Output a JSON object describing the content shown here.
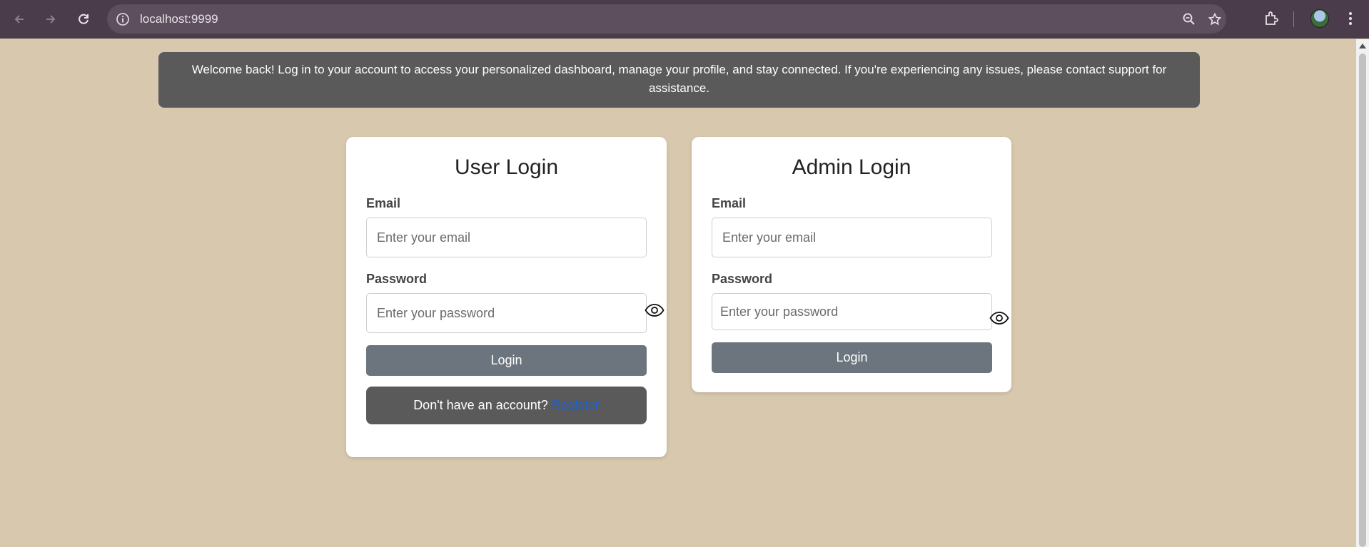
{
  "browser": {
    "url": "localhost:9999",
    "icons": [
      "back-icon",
      "forward-icon",
      "reload-icon",
      "site-info-icon",
      "zoom-icon",
      "bookmark-star-icon",
      "extensions-icon",
      "profile-avatar",
      "menu-icon"
    ]
  },
  "banner": {
    "text": "Welcome back! Log in to your account to access your personalized dashboard, manage your profile, and stay connected. If you're experiencing any issues, please contact support for assistance."
  },
  "user_login": {
    "title": "User Login",
    "email_label": "Email",
    "email_placeholder": "Enter your email",
    "password_label": "Password",
    "password_placeholder": "Enter your password",
    "login_label": "Login",
    "register_prompt": "Don't have an account?",
    "register_link": "Register"
  },
  "admin_login": {
    "title": "Admin Login",
    "email_label": "Email",
    "email_placeholder": "Enter your email",
    "password_label": "Password",
    "password_placeholder": "Enter your password",
    "login_label": "Login"
  },
  "colors": {
    "page_background": "#d8c8ae",
    "banner_background": "#5a5a5a",
    "button_background": "#6c757d",
    "link": "#1a5fd1"
  }
}
